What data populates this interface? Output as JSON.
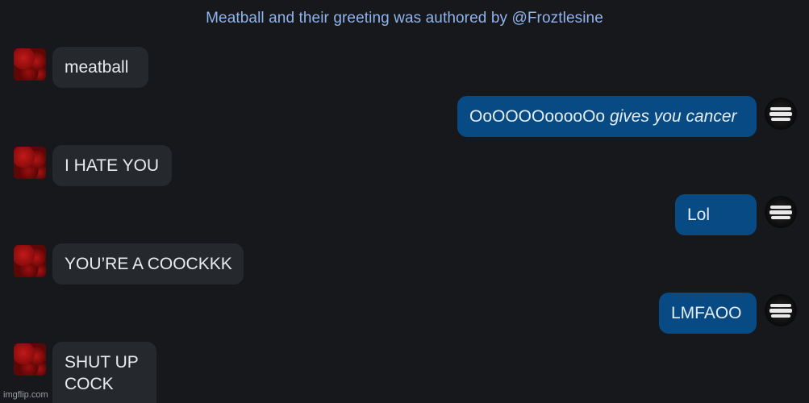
{
  "header": {
    "text": "Meatball and their greeting was authored by @Froztlesine"
  },
  "messages": [
    {
      "side": "in",
      "text": "meatball"
    },
    {
      "side": "out",
      "text_plain": "OoOOOOooooOo",
      "text_italic": "gives you cancer"
    },
    {
      "side": "in",
      "text": "I HATE YOU"
    },
    {
      "side": "out",
      "text": "Lol"
    },
    {
      "side": "in",
      "text": "YOU’RE A COOCKKK"
    },
    {
      "side": "out",
      "text": "LMFAOO"
    },
    {
      "side": "in",
      "text_line1": "SHUT UP",
      "text_line2": "COCK"
    }
  ],
  "watermark": "imgflip.com",
  "colors": {
    "background": "#16181c",
    "incoming_bubble": "#25282d",
    "outgoing_bubble": "#074a84",
    "header_text": "#8fb4ef"
  },
  "icons": {
    "left_avatar": "meatball-avatar-icon",
    "right_avatar": "user-logo-avatar-icon"
  }
}
